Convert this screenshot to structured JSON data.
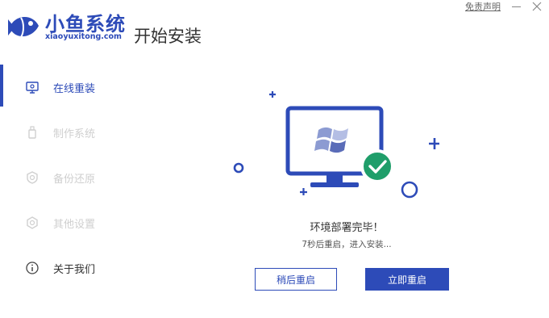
{
  "header": {
    "brand_name": "小鱼系统",
    "brand_sub": "xiaoyuxitong.com",
    "page_title": "开始安装",
    "disclaimer": "免责声明"
  },
  "sidebar": {
    "items": [
      {
        "label": "在线重装",
        "icon": "monitor-icon",
        "state": "active"
      },
      {
        "label": "制作系统",
        "icon": "usb-drive-icon",
        "state": "disabled"
      },
      {
        "label": "备份还原",
        "icon": "backup-restore-icon",
        "state": "disabled"
      },
      {
        "label": "其他设置",
        "icon": "gear-icon",
        "state": "disabled"
      },
      {
        "label": "关于我们",
        "icon": "info-icon",
        "state": "normal"
      }
    ]
  },
  "main": {
    "status_text": "环境部署完毕！",
    "countdown_text": "7秒后重启，进入安装...",
    "later_button": "稍后重启",
    "now_button": "立即重启"
  },
  "colors": {
    "accent": "#2d4bb8",
    "success": "#1f9e6a",
    "disabled": "#cfcfcf"
  }
}
